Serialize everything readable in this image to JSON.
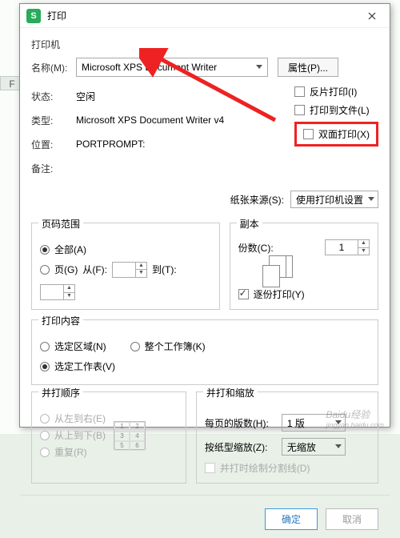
{
  "sheet": {
    "col": "F"
  },
  "dialog": {
    "title": "打印",
    "printer_section": "打印机",
    "name_label": "名称(M):",
    "name_value": "Microsoft XPS Document Writer",
    "properties_btn": "属性(P)...",
    "status_label": "状态:",
    "status_value": "空闲",
    "type_label": "类型:",
    "type_value": "Microsoft XPS Document Writer v4",
    "where_label": "位置:",
    "where_value": "PORTPROMPT:",
    "comment_label": "备注:",
    "reverse_print": "反片打印(I)",
    "print_to_file": "打印到文件(L)",
    "duplex": "双面打印(X)",
    "paper_source_label": "纸张来源(S):",
    "paper_source_value": "使用打印机设置",
    "range": {
      "title": "页码范围",
      "all": "全部(A)",
      "pages": "页(G)",
      "from": "从(F):",
      "to": "到(T):"
    },
    "copies": {
      "title": "副本",
      "count_label": "份数(C):",
      "count_value": "1",
      "collate": "逐份打印(Y)"
    },
    "content": {
      "title": "打印内容",
      "selection": "选定区域(N)",
      "workbook": "整个工作簿(K)",
      "sheets": "选定工作表(V)"
    },
    "order": {
      "title": "并打顺序",
      "lr": "从左到右(E)",
      "tb": "从上到下(B)",
      "repeat": "重复(R)"
    },
    "scale": {
      "title": "并打和缩放",
      "per_page_label": "每页的版数(H):",
      "per_page_value": "1 版",
      "scale_label": "按纸型缩放(Z):",
      "scale_value": "无缩放",
      "cutlines": "并打时绘制分割线(D)"
    },
    "ok": "确定",
    "cancel": "取消"
  },
  "watermark": {
    "main": "Baidu经验",
    "sub": "jingyan.baidu.com"
  }
}
